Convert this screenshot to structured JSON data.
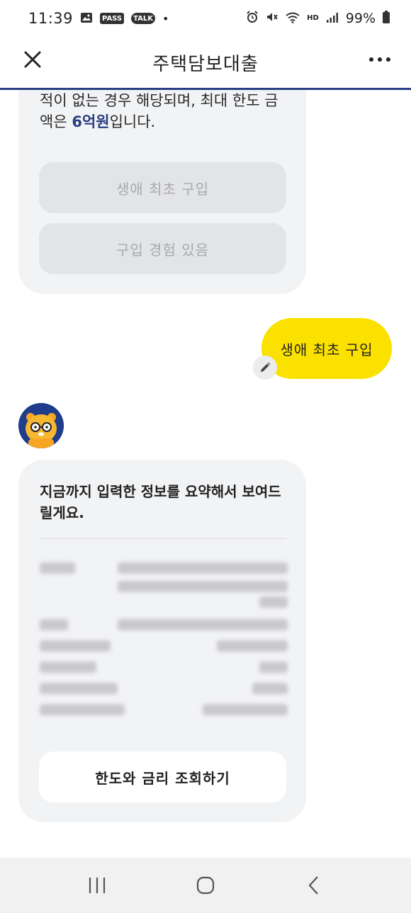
{
  "status_bar": {
    "time": "11:39",
    "pass_label": "PASS",
    "talk_label": "TALK",
    "dot": "•",
    "hd_label": "HD",
    "battery": "99%",
    "icons": [
      "gallery-icon",
      "pass-icon",
      "kakaotalk-icon",
      "alarm-icon",
      "mute-icon",
      "wifi-icon",
      "hd-voice-icon",
      "signal-icon",
      "battery-icon"
    ]
  },
  "header": {
    "title": "주택담보대출",
    "close_icon": "close-icon",
    "more_icon": "more-icon",
    "progress_color": "#2a3e82",
    "progress": 1.0
  },
  "question_card": {
    "text_prefix": "적이 없는 경우 해당되며, 최대 한도 금액은 ",
    "text_highlight": "6억원",
    "text_suffix": "입니다.",
    "choices": [
      "생애 최초 구입",
      "구입 경험 있음"
    ]
  },
  "user_reply": {
    "text": "생애 최초 구입",
    "edit_icon": "pencil-icon",
    "bubble_color": "#fbe100"
  },
  "summary_card": {
    "title": "지금까지 입력한 정보를 요약해서 보여드릴게요.",
    "cta_label": "한도와 금리 조회하기"
  },
  "nav_bar": {
    "icons": [
      "recent-apps-icon",
      "home-icon",
      "back-icon"
    ]
  },
  "colors": {
    "accent": "#2a3e82",
    "user_bubble": "#fbe100",
    "card_bg": "#f2f3f5"
  }
}
